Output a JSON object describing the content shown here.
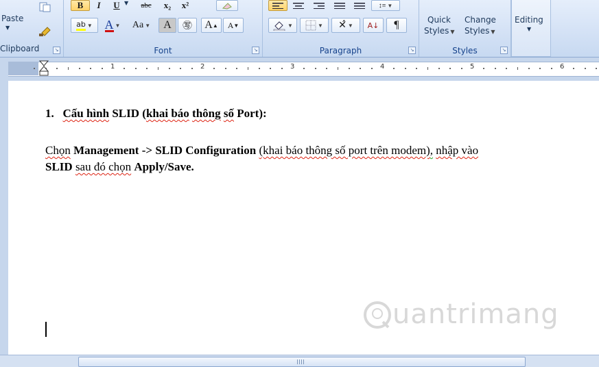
{
  "ribbon": {
    "clipboard": {
      "paste_label": "Paste",
      "group_label": "Clipboard"
    },
    "font": {
      "group_label": "Font",
      "bold": "B",
      "italic": "I",
      "underline": "U",
      "strikethrough": "abc",
      "subscript": "x₂",
      "superscript": "x²",
      "change_case": "Aa",
      "highlight": "A",
      "phonetic": "㊢",
      "grow_font": "A",
      "shrink_font": "A",
      "font_color": "A"
    },
    "paragraph": {
      "group_label": "Paragraph",
      "sort": "A↓",
      "show_marks": "¶"
    },
    "styles": {
      "group_label": "Styles",
      "quick_styles": "Quick",
      "quick_styles_2": "Styles",
      "change_styles": "Change",
      "change_styles_2": "Styles"
    },
    "editing": {
      "label": "Editing"
    }
  },
  "ruler": {
    "numbers": [
      "1",
      "2",
      "3",
      "4",
      "5",
      "6"
    ]
  },
  "document": {
    "heading_number": "1.",
    "heading_parts": [
      "Cấu hình",
      " SLID (",
      "khai báo",
      " ",
      "thông",
      " ",
      "số",
      " Port):"
    ],
    "para1": {
      "p1": "Chọn",
      "p2": "Management",
      "p3": "-> SLID Configuration",
      "p4": "(khai báo thông số port trên modem)",
      "p5": ",",
      "p6": "nhập vào"
    },
    "para2": {
      "p1": "SLID",
      "p2": "sau đó chọn",
      "p3": "Apply/Save."
    }
  },
  "watermark": {
    "text": "uantrimang"
  },
  "colors": {
    "ribbon": "#d3e1f5",
    "accent": "#15428b",
    "active_button": "#ffd36b"
  }
}
